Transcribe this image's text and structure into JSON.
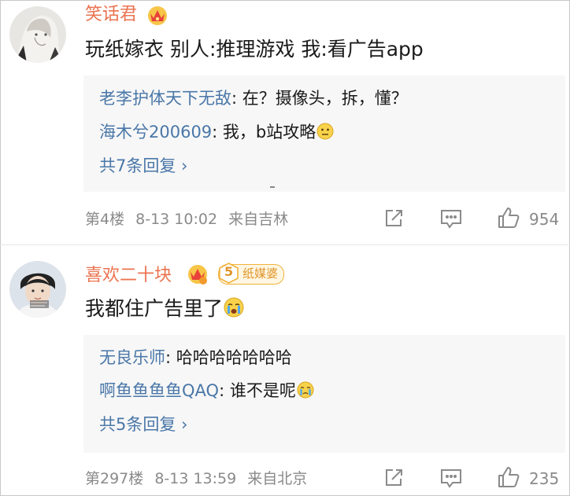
{
  "comments": [
    {
      "username": "笑话君",
      "content": "玩纸嫁衣 别人:推理游戏 我:看广告app",
      "replies": [
        {
          "user": "老李护体天下无敌",
          "text": ": 在？摄像头，拆，懂？",
          "emoji": ""
        },
        {
          "user": "海木兮200609",
          "text": ": 我，b站攻略",
          "emoji": "awkward-emoji"
        }
      ],
      "more_replies": "共7条回复 ›",
      "floor": "第4楼",
      "date": "8-13 10:02",
      "location": "来自吉林",
      "likes": "954"
    },
    {
      "username": "喜欢二十块",
      "badge_level": "5",
      "badge_label": "纸媒婆",
      "content": "我都住广告里了",
      "content_emoji": "crying-emoji",
      "replies": [
        {
          "user": "无良乐师",
          "text": ": 哈哈哈哈哈哈哈",
          "emoji": ""
        },
        {
          "user": "啊鱼鱼鱼鱼QAQ",
          "text": ": 谁不是呢",
          "emoji": "sad-emoji"
        }
      ],
      "more_replies": "共5条回复 ›",
      "floor": "第297楼",
      "date": "8-13 13:59",
      "location": "来自北京",
      "likes": "235"
    }
  ],
  "colors": {
    "username": "#eb7350",
    "reply_user": "#4a77a8",
    "meta": "#8a8a8a",
    "reply_bg": "#f7f7f7"
  }
}
